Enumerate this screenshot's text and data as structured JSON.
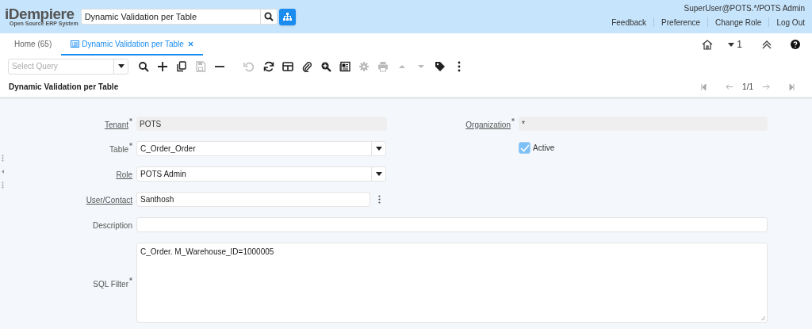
{
  "header": {
    "logo": "iDempiere",
    "logo_subtitle": "Open Source ERP System",
    "search": {
      "value": "Dynamic Validation per Table"
    },
    "user": "SuperUser@POTS.*/POTS Admin",
    "links": [
      "Feedback",
      "Preference",
      "Change Role",
      "Log Out"
    ]
  },
  "tabs": [
    {
      "label": "Home (65)",
      "selected": false,
      "closable": false
    },
    {
      "label": "Dynamic Validation per Table",
      "selected": true,
      "closable": true
    }
  ],
  "tab_bar_right": {
    "counter": "1"
  },
  "toolbar": {
    "query": {
      "placeholder": "Select Query"
    },
    "buttons": [
      {
        "disabled": false
      },
      {
        "disabled": false
      },
      {
        "disabled": false
      },
      {
        "disabled": true
      },
      {
        "disabled": false
      },
      {
        "disabled": true
      },
      {
        "disabled": false
      },
      {
        "disabled": false
      },
      {
        "disabled": false
      },
      {
        "disabled": false
      },
      {
        "disabled": false
      },
      {
        "disabled": true
      },
      {
        "disabled": true
      },
      {
        "disabled": true
      },
      {
        "disabled": true
      },
      {
        "disabled": false
      },
      {
        "disabled": false
      }
    ]
  },
  "title_bar": {
    "title": "Dynamic Validation per Table",
    "record": "1/1"
  },
  "form": {
    "rows": [
      [
        {
          "kind": "readonly",
          "label": "Tenant",
          "value": "POTS",
          "required": true,
          "underlined": true
        },
        {
          "kind": "readonly",
          "label": "Organization",
          "value": "*",
          "required": true,
          "underlined": true
        }
      ],
      [
        {
          "kind": "select",
          "label": "Table",
          "value": "C_Order_Order",
          "required": true,
          "underlined": false
        },
        {
          "kind": "checkbox",
          "label": "Active",
          "checked": true
        }
      ],
      [
        {
          "kind": "select",
          "label": "Role",
          "value": "POTS Admin",
          "required": false,
          "underlined": true
        }
      ],
      [
        {
          "kind": "search",
          "label": "User/Contact",
          "value": "Santhosh",
          "required": false,
          "underlined": true
        }
      ],
      [
        {
          "kind": "text",
          "label": "Description",
          "required": false,
          "underlined": false
        }
      ],
      [
        {
          "kind": "textarea",
          "label": "SQL Filter",
          "value": "C_Order. M_Warehouse_ID=1000005",
          "required": true,
          "underlined": false
        }
      ]
    ]
  }
}
